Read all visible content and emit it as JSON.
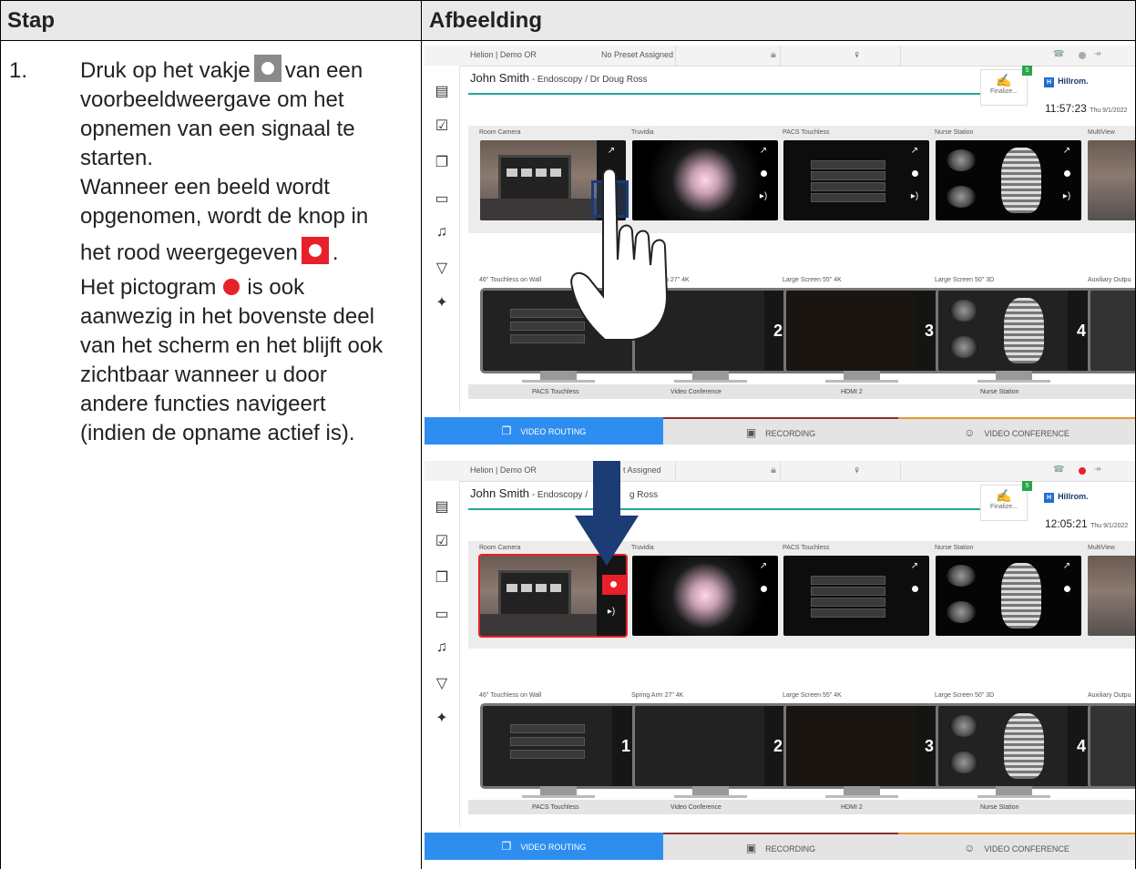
{
  "table": {
    "col_step": "Stap",
    "col_image": "Afbeelding"
  },
  "step": {
    "number": "1.",
    "line1a": "Druk op het vakje",
    "line1b": "van een",
    "line2": "voorbeeldweergave om het",
    "line3": "opnemen van een signaal te",
    "line4": "starten.",
    "line5": "Wanneer een beeld wordt",
    "line6": "opgenomen, wordt de knop in",
    "line7": "het rood weergegeven",
    "line8a": "Het pictogram",
    "line8b": "is ook",
    "line9": "aanwezig in het bovenste deel",
    "line10": "van het scherm en het blijft ook",
    "line11": "zichtbaar wanneer u door",
    "line12": "andere functies navigeert",
    "line13": "(indien de opname actief is)."
  },
  "screen1": {
    "room": "Helion | Demo OR",
    "preset": "No Preset Assigned",
    "patient_name": "John Smith",
    "patient_sub": " - Endoscopy / Dr Doug Ross",
    "finalize": "Finalize...",
    "badge": "5",
    "brand": "Hillrom.",
    "time": "11:57:23",
    "date": "Thu 9/1/2022"
  },
  "screen2": {
    "room": "Helion | Demo OR",
    "preset": "t Assigned",
    "patient_name": "John Smith",
    "patient_sub": " - Endoscopy /",
    "patient_sub2": "g Ross",
    "finalize": "Finalize...",
    "badge": "5",
    "brand": "Hillrom.",
    "time": "12:05:21",
    "date": "Thu 9/1/2022"
  },
  "sources": [
    "Room Camera",
    "Truvidia",
    "PACS Touchless",
    "Nurse Station",
    "MultiView"
  ],
  "monitors_1": [
    "46\" Touchless on Wall",
    "pring Arm 27\" 4K",
    "Large Screen 55\" 4K",
    "Large Screen 50\" 3D",
    "Auxiliary Outpu"
  ],
  "monitors_2": [
    "46\" Touchless on Wall",
    "Spring Arm 27\" 4K",
    "Large Screen 55\" 4K",
    "Large Screen 50\" 3D",
    "Auxiliary Outpu"
  ],
  "monitor_numbers": [
    "1",
    "2",
    "3",
    "4"
  ],
  "destinations": [
    "PACS Touchless",
    "Video Conference",
    "HDMI 2",
    "Nurse Station"
  ],
  "tabs": {
    "video_routing": "VIDEO ROUTING",
    "recording": "RECORDING",
    "video_conference": "VIDEO CONFERENCE"
  },
  "icons": {
    "record": "record-icon",
    "expand": "expand-icon",
    "stream": "stream-icon",
    "lock": "lock-icon",
    "person": "person-icon"
  },
  "colors": {
    "record_red": "#e8202a",
    "teal": "#20a79a",
    "tab_blue": "#2e8ef0",
    "arrow_blue": "#1b3c74"
  }
}
